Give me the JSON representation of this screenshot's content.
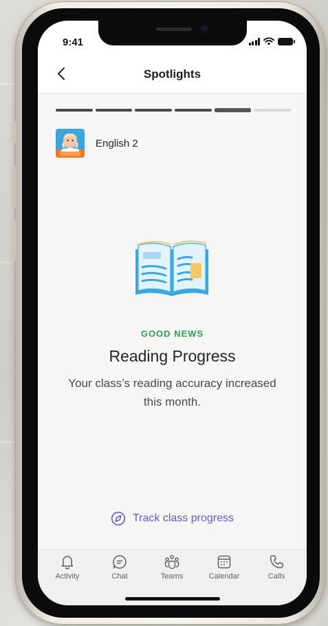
{
  "status_bar": {
    "time": "9:41"
  },
  "nav": {
    "title": "Spotlights",
    "back_icon": "chevron-left-icon"
  },
  "progress": {
    "total_steps": 6,
    "current_step": 5
  },
  "class": {
    "name": "English 2",
    "avatar_icon": "shakespeare-avatar-icon"
  },
  "card": {
    "illustration_icon": "open-book-icon",
    "eyebrow": "GOOD NEWS",
    "headline": "Reading Progress",
    "body": "Your class’s reading accuracy increased this month."
  },
  "action": {
    "label": "Track class progress",
    "icon": "compass-icon"
  },
  "tabs": [
    {
      "label": "Activity",
      "icon": "bell-icon"
    },
    {
      "label": "Chat",
      "icon": "chat-icon"
    },
    {
      "label": "Teams",
      "icon": "teams-icon"
    },
    {
      "label": "Calendar",
      "icon": "calendar-icon"
    },
    {
      "label": "Calls",
      "icon": "phone-icon"
    }
  ],
  "colors": {
    "accent": "#5b5fc7",
    "good_news": "#2e9c5a",
    "screen_bg": "#f7f6f5"
  }
}
